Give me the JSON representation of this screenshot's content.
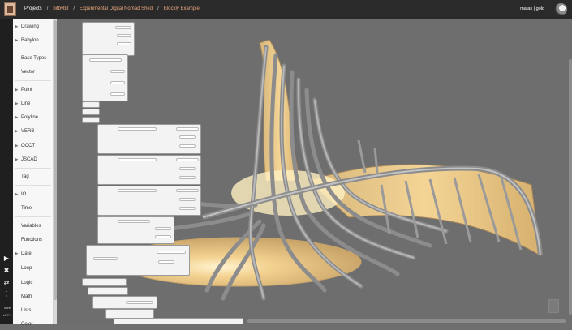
{
  "header": {
    "breadcrumbs": [
      "Projects",
      "bitbybit",
      "Experimental Digital Nomad Shed",
      "Blockly Example"
    ],
    "separator": "/",
    "user_name": "matas | gold"
  },
  "toolstrip": {
    "version_label": "core",
    "version": "v0.7.1"
  },
  "sidebar": {
    "items": [
      {
        "label": "Drawing",
        "chevron": true
      },
      {
        "label": "Babylon",
        "chevron": true
      },
      {
        "label": "Base Types",
        "chevron": false
      },
      {
        "label": "Vector",
        "chevron": false
      },
      {
        "label": "Point",
        "chevron": true
      },
      {
        "label": "Line",
        "chevron": true
      },
      {
        "label": "Polyline",
        "chevron": true
      },
      {
        "label": "VERB",
        "chevron": true
      },
      {
        "label": "OCCT",
        "chevron": true
      },
      {
        "label": "JSCAD",
        "chevron": true
      },
      {
        "label": "Tag",
        "chevron": false
      },
      {
        "label": "IO",
        "chevron": true
      },
      {
        "label": "Time",
        "chevron": false
      },
      {
        "label": "Variables",
        "chevron": false
      },
      {
        "label": "Functions",
        "chevron": false
      },
      {
        "label": "Date",
        "chevron": true
      },
      {
        "label": "Loop",
        "chevron": false
      },
      {
        "label": "Logic",
        "chevron": false
      },
      {
        "label": "Math",
        "chevron": false
      },
      {
        "label": "Lists",
        "chevron": false
      },
      {
        "label": "Color",
        "chevron": false
      }
    ]
  },
  "colors": {
    "accent_link": "#e9a77e",
    "shell_fill": "#f0c98a",
    "rib_stroke": "#9a9a9a",
    "workspace_bg": "#6e6e6e"
  }
}
